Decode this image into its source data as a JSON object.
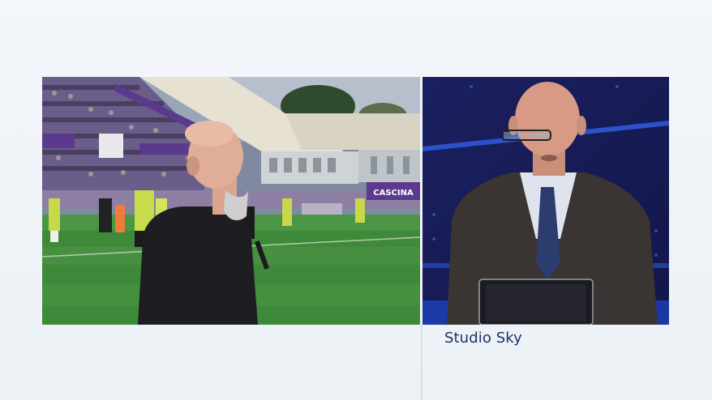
{
  "broadcast": {
    "caption": "Studio Sky",
    "stadium_banner": "CASCINA",
    "colors": {
      "caption_text": "#1e2f6b",
      "pitch": "#3f8a3a",
      "studio_blue": "#1a1f58",
      "fiorentina_purple": "#5b3a8e"
    }
  },
  "panels": {
    "left": {
      "scene": "stadium-sideline-feed"
    },
    "right": {
      "scene": "studio-presenter-feed"
    }
  }
}
